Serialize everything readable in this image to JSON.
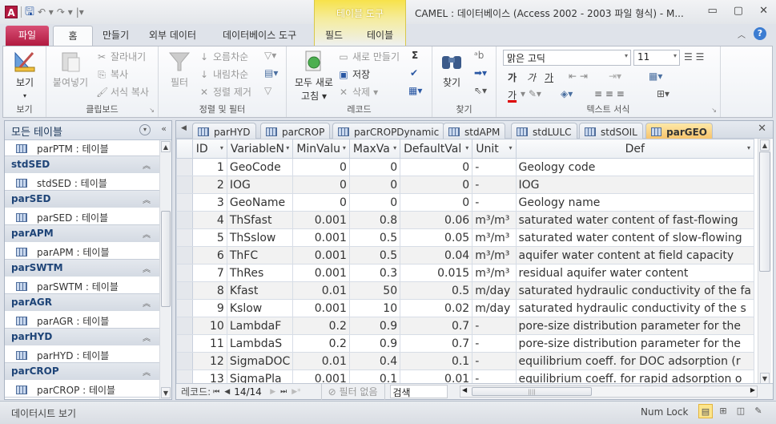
{
  "titlebar": {
    "app_icon": "A",
    "qat_items": [
      "save-icon",
      "undo-icon",
      "redo-icon",
      "customize-qat-icon"
    ],
    "window_title": "CAMEL : 데이터베이스 (Access 2002 - 2003 파일 형식) - M...",
    "controls": {
      "minimize": "▭",
      "maximize": "▢",
      "close": "✕"
    }
  },
  "ribbon_tabs": {
    "file": "파일",
    "tabs": [
      "홈",
      "만들기",
      "외부 데이터",
      "데이터베이스 도구"
    ],
    "context_group": "테이블 도구",
    "context_tabs": [
      "필드",
      "테이블"
    ],
    "active": "홈"
  },
  "ribbon": {
    "view": {
      "label": "보기",
      "group": "보기"
    },
    "clipboard": {
      "paste": "붙여넣기",
      "cut": "잘라내기",
      "copy": "복사",
      "format_painter": "서식 복사",
      "group": "클립보드"
    },
    "sort_filter": {
      "filter": "필터",
      "ascending": "오름차순",
      "descending": "내림차순",
      "remove_sort": "정렬 제거",
      "group": "정렬 및 필터"
    },
    "records": {
      "refresh_all": "모두 새로",
      "refresh_all_2": "고침",
      "new": "새로 만들기",
      "save": "저장",
      "delete": "삭제",
      "totals": "Σ",
      "group": "레코드"
    },
    "find": {
      "find": "찾기",
      "group": "찾기"
    },
    "text_format": {
      "font": "맑은 고딕",
      "size": "11",
      "bold": "가",
      "italic": "가",
      "underline": "가",
      "font_color": "가",
      "group": "텍스트 서식"
    }
  },
  "nav_pane": {
    "title": "모든 테이블",
    "partial_top": {
      "item": "parPTM : 테이블"
    },
    "groups": [
      {
        "name": "stdSED",
        "item": "stdSED : 테이블"
      },
      {
        "name": "parSED",
        "item": "parSED : 테이블"
      },
      {
        "name": "parAPM",
        "item": "parAPM : 테이블"
      },
      {
        "name": "parSWTM",
        "item": "parSWTM : 테이블"
      },
      {
        "name": "parAGR",
        "item": "parAGR : 테이블"
      },
      {
        "name": "parHYD",
        "item": "parHYD : 테이블"
      },
      {
        "name": "parCROP",
        "item": "parCROP : 테이블"
      }
    ]
  },
  "doc_tabs": [
    "parHYD",
    "parCROP",
    "parCROPDynamic",
    "stdAPM",
    "stdLULC",
    "stdSOIL",
    "parGEO"
  ],
  "active_doc_tab": "parGEO",
  "table": {
    "columns": [
      "ID",
      "VariableN",
      "MinValu",
      "MaxVa",
      "DefaultVal",
      "Unit",
      "Def"
    ],
    "rows": [
      [
        "1",
        "GeoCode",
        "0",
        "0",
        "0",
        "-",
        "Geology code"
      ],
      [
        "2",
        "IOG",
        "0",
        "0",
        "0",
        "-",
        "IOG"
      ],
      [
        "3",
        "GeoName",
        "0",
        "0",
        "0",
        "-",
        "Geology name"
      ],
      [
        "4",
        "ThSfast",
        "0.001",
        "0.8",
        "0.06",
        "m³/m³",
        "saturated water content of fast-flowing"
      ],
      [
        "5",
        "ThSslow",
        "0.001",
        "0.5",
        "0.05",
        "m³/m³",
        "saturated water content of slow-flowing"
      ],
      [
        "6",
        "ThFC",
        "0.001",
        "0.5",
        "0.04",
        "m³/m³",
        "aquifer water content at field capacity"
      ],
      [
        "7",
        "ThRes",
        "0.001",
        "0.3",
        "0.015",
        "m³/m³",
        "residual aquifer water content"
      ],
      [
        "8",
        "Kfast",
        "0.01",
        "50",
        "0.5",
        "m/day",
        "saturated hydraulic conductivity of the fa"
      ],
      [
        "9",
        "Kslow",
        "0.001",
        "10",
        "0.02",
        "m/day",
        "saturated hydraulic conductivity of the s"
      ],
      [
        "10",
        "LambdaF",
        "0.2",
        "0.9",
        "0.7",
        "-",
        "pore-size distribution parameter for the"
      ],
      [
        "11",
        "LambdaS",
        "0.2",
        "0.9",
        "0.7",
        "-",
        "pore-size distribution parameter for the"
      ],
      [
        "12",
        "SigmaDOC",
        "0.01",
        "0.4",
        "0.1",
        "-",
        "equilibrium coeff. for DOC adsorption (r"
      ],
      [
        "13",
        "SigmaPla",
        "0.001",
        "0.1",
        "0.01",
        "-",
        "equilibrium coeff. for rapid adsorption o"
      ]
    ]
  },
  "record_nav": {
    "label": "레코드:",
    "current": "14/14",
    "filter": "필터 없음",
    "search": "검색"
  },
  "status": {
    "left": "데이터시트 보기",
    "numlock": "Num Lock"
  }
}
